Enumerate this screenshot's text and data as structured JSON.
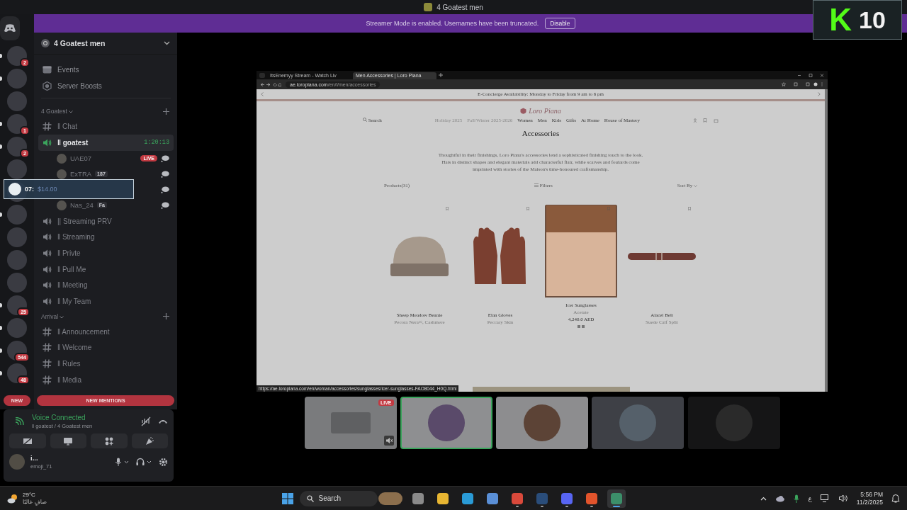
{
  "window": {
    "title": "4 Goatest men"
  },
  "banner": {
    "text": "Streamer Mode is enabled. Usernames have been truncated.",
    "button": "Disable"
  },
  "overlay_logo": {
    "letter": "K",
    "number": "10"
  },
  "server_rail": [
    {
      "kind": "home",
      "unread": false
    },
    {
      "kind": "server",
      "badge": "2",
      "unread": true
    },
    {
      "kind": "server",
      "unread": true
    },
    {
      "kind": "server",
      "unread": false
    },
    {
      "kind": "server",
      "badge": "1",
      "unread": true
    },
    {
      "kind": "server",
      "badge": "2",
      "unread": true
    },
    {
      "kind": "server",
      "unread": false
    },
    {
      "kind": "server",
      "unread": false
    },
    {
      "kind": "server",
      "unread": true
    },
    {
      "kind": "server",
      "unread": false
    },
    {
      "kind": "server",
      "unread": false
    },
    {
      "kind": "server",
      "unread": false
    },
    {
      "kind": "server",
      "badge": "25",
      "unread": true
    },
    {
      "kind": "server",
      "unread": true
    },
    {
      "kind": "server",
      "badge": "544",
      "unread": true
    },
    {
      "kind": "server",
      "badge": "48",
      "unread": true
    }
  ],
  "new_pill": "NEW",
  "server": {
    "name": "4 Goatest men"
  },
  "nav_items": [
    {
      "kind": "events",
      "label": "Events"
    },
    {
      "kind": "boosts",
      "label": "Server Boosts"
    }
  ],
  "categories": [
    {
      "name": "4 Goatest",
      "channels": [
        {
          "kind": "text",
          "name": "‖ Chat",
          "selected": false
        },
        {
          "kind": "voice",
          "name": "‖ goatest",
          "selected": true,
          "timer": "1:20:13",
          "members": [
            {
              "kind": "user",
              "name": "UAE07",
              "live": "LIVE"
            },
            {
              "kind": "user",
              "name": "ExTRA",
              "badge": "187"
            },
            {
              "kind": "covered"
            },
            {
              "kind": "user",
              "name": "Nas_24",
              "badge": "Fa"
            }
          ]
        },
        {
          "kind": "voice",
          "name": "|| Streaming PRV",
          "selected": false
        },
        {
          "kind": "voice",
          "name": "‖ Streaming",
          "selected": false
        },
        {
          "kind": "voice",
          "name": "‖ Privte",
          "selected": false
        },
        {
          "kind": "voice",
          "name": "‖ Pull Me",
          "selected": false
        },
        {
          "kind": "voice",
          "name": "‖ Meeting",
          "selected": false
        },
        {
          "kind": "voice",
          "name": "‖ My Team",
          "selected": false
        }
      ]
    },
    {
      "name": "Arrival",
      "channels": [
        {
          "kind": "text",
          "name": "‖ Announcement",
          "selected": false
        },
        {
          "kind": "text",
          "name": "‖ Welcome",
          "selected": false
        },
        {
          "kind": "text",
          "name": "‖ Rules",
          "selected": false
        },
        {
          "kind": "text",
          "name": "‖ Media",
          "selected": false
        }
      ]
    }
  ],
  "floating_widget": {
    "label": "07:",
    "amount": "$14.00"
  },
  "new_mentions": "NEW MENTIONS",
  "voice_panel": {
    "status": "Voice Connected",
    "location": "‖ goatest / 4 Goatest men"
  },
  "user_panel": {
    "name": "i...",
    "status": "emoji_71"
  },
  "stream": {
    "tabs": [
      {
        "title": "ItsEnemyy Stream - Watch Liv",
        "selected": false
      },
      {
        "title": "Men Accessories | Loro Piana",
        "selected": true
      }
    ],
    "url_host": "ae.loropiana.com",
    "url_path": "/en/l/men/accessories",
    "promo": "E-Concierge Availability: Monday to Friday from 9 am to 6 pm",
    "brand": "Loro Piana",
    "search": "Search",
    "nav": [
      {
        "label": "Holiday 2025",
        "muted": true
      },
      {
        "label": "Fall/Winter 2025-2026",
        "muted": true
      },
      {
        "label": "Women",
        "muted": false
      },
      {
        "label": "Men",
        "muted": false
      },
      {
        "label": "Kids",
        "muted": false
      },
      {
        "label": "Gifts",
        "muted": false
      },
      {
        "label": "At Home",
        "muted": false
      },
      {
        "label": "House of Mastery",
        "muted": false
      }
    ],
    "heading": "Accessories",
    "description": "Thoughtful in their finishings, Loro Piana's accessories lend a sophisticated finishing touch to the look. Hats in distinct shapes and elegant materials add characterful flair, while scarves and foulards come imprinted with stories of the Maison's time-honoured craftsmanship.",
    "products_count": "Products(31)",
    "filters": "Filters",
    "sort": "Sort By",
    "products": [
      {
        "kind": "beanie",
        "name": "Sheep Meadow Beanie",
        "material": "Pecora Nera®, Cashmere"
      },
      {
        "kind": "gloves",
        "name": "Elan Gloves",
        "material": "Peccary Skin"
      },
      {
        "kind": "photo",
        "name": "Icer Sunglasses",
        "material": "Acetate",
        "price": "4,240.0 AED"
      },
      {
        "kind": "belt",
        "name": "Alacel Belt",
        "material": "Suede Calf Split"
      }
    ],
    "status_url": "https://ae.loropiana.com/en/woman/accessories/sunglasses/icer-sunglasses-FAO8044_H0Q.html"
  },
  "tiles": [
    {
      "kind": "stream",
      "selected": false,
      "badge": "LIVE"
    },
    {
      "kind": "avatar",
      "selected": true
    },
    {
      "kind": "avatar",
      "selected": false
    },
    {
      "kind": "avatar",
      "selected": false
    },
    {
      "kind": "avatar",
      "selected": false
    }
  ],
  "taskbar": {
    "temperature": "29°C",
    "condition": "صافٍ غالبًا",
    "search": "Search",
    "apps": [
      {
        "kind": "taskview",
        "running": false,
        "active": false
      },
      {
        "kind": "folder",
        "running": false,
        "active": false
      },
      {
        "kind": "edge",
        "running": false,
        "active": false
      },
      {
        "kind": "store",
        "running": false,
        "active": false
      },
      {
        "kind": "chrome",
        "running": true,
        "active": false
      },
      {
        "kind": "steam",
        "running": true,
        "active": false
      },
      {
        "kind": "discord",
        "running": true,
        "active": false
      },
      {
        "kind": "brave",
        "running": true,
        "active": false
      },
      {
        "kind": "app",
        "running": true,
        "active": true
      }
    ],
    "language": "ع",
    "time": "5:56 PM",
    "date": "11/2/2025"
  }
}
